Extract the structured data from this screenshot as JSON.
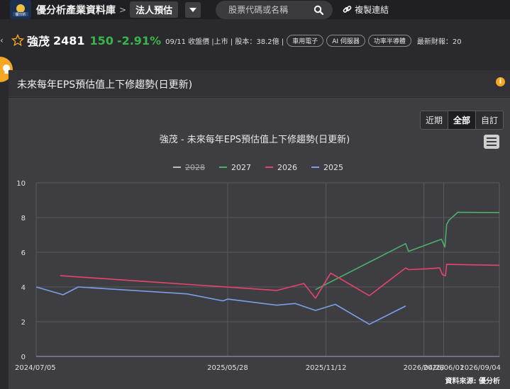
{
  "header": {
    "logo_text": "優分析",
    "site_name": "優分析產業資料庫",
    "breadcrumb_sep": ">",
    "breadcrumb_current": "法人預估",
    "search_placeholder": "股票代碼或名稱",
    "copy_link_label": "複製連結"
  },
  "stock": {
    "name": "強茂",
    "code": "2481",
    "price": "150",
    "change": "-2.91%",
    "meta": "09/11 收盤價 |上市 | 股本：38.2億 |",
    "tags": [
      "車用電子",
      "AI 伺服器",
      "功率半導體"
    ],
    "financial_label": "最新財報：20"
  },
  "panel": {
    "title": "未來每年EPS預估值上下修趨勢(日更新)"
  },
  "range_buttons": [
    {
      "label": "近期",
      "active": false
    },
    {
      "label": "全部",
      "active": true
    },
    {
      "label": "自訂",
      "active": false
    }
  ],
  "source_label": "資料來源: 優分析",
  "colors": {
    "accent": "#f5a623",
    "down": "#39b54a",
    "s2028": "#bdbdbd",
    "s2027": "#4caf6a",
    "s2026": "#e8436f",
    "s2025": "#7b9fe8"
  },
  "chart_data": {
    "type": "line",
    "title": "強茂 - 未來每年EPS預估值上下修趨勢(日更新)",
    "x_ticks": [
      "2024/07/05",
      "2025/05/28",
      "2025/11/12",
      "2026/04/28",
      "2026/06/01",
      "2026/09/04"
    ],
    "y_ticks": [
      0,
      2,
      4,
      6,
      8,
      10
    ],
    "ylim": [
      0,
      10
    ],
    "legend_position": "top-center",
    "grid": true,
    "series": [
      {
        "name": "2028",
        "legend_struck": true,
        "points": []
      },
      {
        "name": "2027",
        "points": [
          [
            "2025/10/25",
            3.85
          ],
          [
            "2026/03/28",
            6.5
          ],
          [
            "2026/04/02",
            6.05
          ],
          [
            "2026/05/28",
            6.75
          ],
          [
            "2026/06/03",
            6.3
          ],
          [
            "2026/06/06",
            7.6
          ],
          [
            "2026/06/10",
            7.85
          ],
          [
            "2026/06/25",
            8.3
          ],
          [
            "2026/09/04",
            8.28
          ]
        ]
      },
      {
        "name": "2026",
        "points": [
          [
            "2024/08/15",
            4.65
          ],
          [
            "2025/08/20",
            3.8
          ],
          [
            "2025/10/05",
            4.2
          ],
          [
            "2025/10/25",
            3.35
          ],
          [
            "2025/11/20",
            4.8
          ],
          [
            "2026/01/25",
            3.5
          ],
          [
            "2026/03/28",
            5.1
          ],
          [
            "2026/04/02",
            5.0
          ],
          [
            "2026/05/05",
            5.05
          ],
          [
            "2026/05/25",
            5.1
          ],
          [
            "2026/05/30",
            4.7
          ],
          [
            "2026/06/04",
            4.65
          ],
          [
            "2026/06/06",
            5.3
          ],
          [
            "2026/09/04",
            5.25
          ]
        ]
      },
      {
        "name": "2025",
        "points": [
          [
            "2024/07/05",
            4.0
          ],
          [
            "2024/08/20",
            3.55
          ],
          [
            "2024/09/15",
            4.0
          ],
          [
            "2025/03/20",
            3.6
          ],
          [
            "2025/05/20",
            3.2
          ],
          [
            "2025/05/28",
            3.3
          ],
          [
            "2025/08/20",
            2.95
          ],
          [
            "2025/09/20",
            3.05
          ],
          [
            "2025/10/25",
            2.65
          ],
          [
            "2025/11/28",
            3.0
          ],
          [
            "2026/01/25",
            1.85
          ],
          [
            "2026/03/28",
            2.9
          ]
        ]
      }
    ]
  }
}
